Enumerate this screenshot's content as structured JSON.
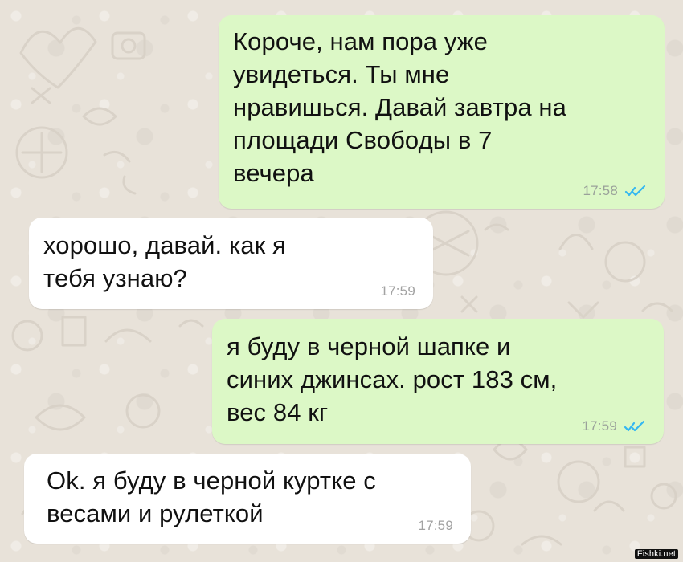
{
  "conversation": {
    "messages": [
      {
        "direction": "outgoing",
        "text": "Короче, нам пора уже\nувидеться. Ты мне\nнравишься. Давай завтра на\nплощади Свободы в 7\nвечера",
        "time": "17:58",
        "status_icon": "double-check-icon"
      },
      {
        "direction": "incoming",
        "text": "хорошо, давай. как я\nтебя узнаю?",
        "time": "17:59"
      },
      {
        "direction": "outgoing",
        "text": "я буду в черной шапке и\nсиних джинсах. рост 183 см,\nвес 84 кг",
        "time": "17:59",
        "status_icon": "double-check-icon"
      },
      {
        "direction": "incoming",
        "text": "Ok. я буду в черной куртке с\nвесами и рулеткой",
        "time": "17:59"
      }
    ]
  },
  "colors": {
    "background": "#e8e2d9",
    "outgoing_bubble": "#dcf8c6",
    "incoming_bubble": "#ffffff",
    "read_checks": "#34b7f1",
    "timestamp": "#9aa19a"
  },
  "watermark": "Fishki.net"
}
